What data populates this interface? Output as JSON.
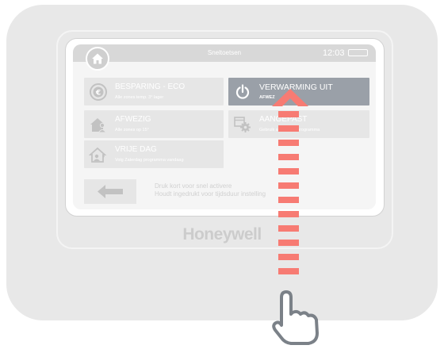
{
  "screen": {
    "title": "Sneltoetsen",
    "time": "12:03"
  },
  "tiles": [
    {
      "title": "BESPARING - ECO",
      "subtitle": "Alle zones temp. 3° lager",
      "icon": "euro-icon"
    },
    {
      "title": "VERWARMING UIT",
      "subtitle": "AFWEZ",
      "icon": "power-icon"
    },
    {
      "title": "AFWEZIG",
      "subtitle": "Alle zones op 15°",
      "icon": "away-house-icon"
    },
    {
      "title": "AANGEPAST",
      "subtitle": "Gebruik aangepast programma",
      "icon": "gear-icon"
    },
    {
      "title": "VRIJE DAG",
      "subtitle": "Volg Zaterdag programma vandaag",
      "icon": "day-off-house-icon"
    }
  ],
  "hint": {
    "line1": "Druk kort voor snel activere",
    "line2": "Houdt ingedrukt voor tijdsduur instelling"
  },
  "brand": "Honeywell",
  "colors": {
    "device": "#e8e8e8",
    "active_tile": "#9aa0a8",
    "arrow": "#f77b73",
    "tile": "#e6e6e6"
  }
}
